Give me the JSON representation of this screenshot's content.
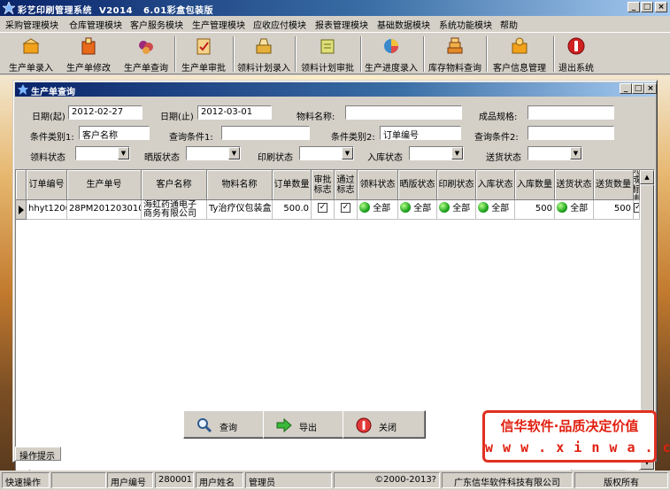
{
  "window": {
    "title": "彩艺印刷管理系统  V2014   6.01彩盒包装版",
    "min": "_",
    "max": "□",
    "close": "×"
  },
  "menu": [
    "采购管理模块",
    "仓库管理模块",
    "客户服务模块",
    "生产管理模块",
    "应收应付模块",
    "报表管理模块",
    "基础数据模块",
    "系统功能模块",
    "帮助"
  ],
  "toolbar": [
    {
      "label": "生产单录入",
      "icon": "box-add-icon",
      "color": "#f2a21a"
    },
    {
      "label": "生产单修改",
      "icon": "box-edit-icon",
      "color": "#e86a1a"
    },
    {
      "label": "生产单查询",
      "icon": "grapes-icon",
      "color": "#9a2a7a"
    },
    {
      "label": "生产单审批",
      "icon": "approve-icon",
      "color": "#d0882a"
    },
    {
      "label": "领料计划录入",
      "icon": "plan-entry-icon",
      "color": "#e7b03a"
    },
    {
      "label": "领料计划审批",
      "icon": "plan-approve-icon",
      "color": "#c9c83a"
    },
    {
      "label": "生产进度录入",
      "icon": "progress-icon",
      "color": "#3a8acb"
    },
    {
      "label": "库存物料查询",
      "icon": "stock-icon",
      "color": "#e38a2a"
    },
    {
      "label": "客户信息管理",
      "icon": "customer-icon",
      "color": "#f2a21a"
    },
    {
      "label": "退出系统",
      "icon": "exit-icon",
      "color": "#d02020"
    }
  ],
  "child": {
    "title": "生产单查询",
    "min": "_",
    "max": "□",
    "close": "×"
  },
  "filters": {
    "date_from_label": "日期(起)",
    "date_from": "2012-02-27",
    "date_to_label": "日期(止)",
    "date_to": "2012-03-01",
    "material_label": "物料名称:",
    "material": "",
    "spec_label": "成品规格:",
    "spec": "",
    "cond_type1_label": "条件类别1:",
    "cond_type1": "客户名称",
    "cond1_label": "查询条件1:",
    "cond1": "",
    "cond_type2_label": "条件类别2:",
    "cond_type2": "订单编号",
    "cond2_label": "查询条件2:",
    "cond2": "",
    "pick_label": "领料状态",
    "plate_label": "晒版状态",
    "print_label": "印刷状态",
    "store_label": "入库状态",
    "deliver_label": "送货状态"
  },
  "grid": {
    "columns": [
      "订单编号",
      "生产单号",
      "客户名称",
      "物料名称",
      "订单数量",
      "审批标志",
      "通过标志",
      "领料状态",
      "晒版状态",
      "印刷状态",
      "入库状态",
      "入库数量",
      "送货状态",
      "送货数量",
      "完成标志"
    ],
    "row": {
      "order_no": "hhyt12001",
      "prod_no": "28PM201203010001",
      "customer": "海虹药通电子商务有限公司",
      "material": "Ty治疗仪包装盒",
      "qty": "500.0",
      "approved": "✓",
      "passed": "✓",
      "pick": "全部",
      "plate": "全部",
      "print": "全部",
      "store": "全部",
      "store_qty": "500",
      "deliver": "全部",
      "deliver_qty": "500",
      "done": "✓"
    }
  },
  "buttons": {
    "query": "查询",
    "export": "导出",
    "close": "关闭"
  },
  "tip_tab": "操作提示",
  "promo": {
    "line1": "信华软件·品质决定价值",
    "line2": "w w w . x i n w a . c n"
  },
  "status": {
    "shortcut": "快速操作",
    "user_no_label": "用户编号",
    "user_no": "280001",
    "user_name_label": "用户姓名",
    "user_name": "管理员",
    "copyright": "©2000-2013?",
    "company": "广东信华软件科技有限公司",
    "rights": "版权所有"
  }
}
